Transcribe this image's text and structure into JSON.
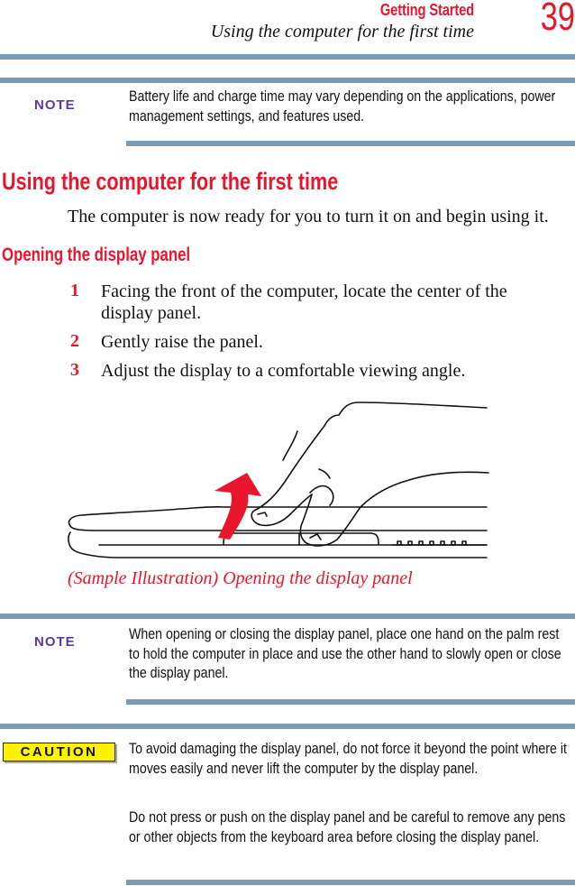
{
  "header": {
    "section": "Getting Started",
    "title": "Using the computer for the first time",
    "page_number": "39"
  },
  "notes": [
    {
      "label": "NOTE",
      "text": "Battery life and charge time may vary depending on the applications, power management settings, and features used."
    },
    {
      "label": "NOTE",
      "text": "When opening or closing the display panel, place one hand on the palm rest to hold the computer in place and use the other hand to slowly open or close the display panel."
    }
  ],
  "section": {
    "heading": "Using the computer for the first time",
    "intro": "The computer is now ready for you to turn it on and begin using it.",
    "subheading": "Opening the display panel",
    "steps": [
      {
        "number": "1",
        "text": "Facing the front of the computer, locate the center of the display panel."
      },
      {
        "number": "2",
        "text": "Gently raise the panel."
      },
      {
        "number": "3",
        "text": "Adjust the display to a comfortable viewing angle."
      }
    ]
  },
  "figure": {
    "icon": "laptop-opening-hand-illustration",
    "caption": "(Sample Illustration) Opening the display panel"
  },
  "caution": {
    "label": "CAUTION",
    "paragraphs": [
      "To avoid damaging the display panel, do not force it beyond the point where it moves easily and never lift the computer by the display panel.",
      "Do not press or push on the display panel and be careful to remove any pens or other objects from the keyboard area before closing the display panel."
    ]
  },
  "colors": {
    "accent_red": "#e8152c",
    "note_purple": "#5b3aa1",
    "rule_blue": "#7c9ab4",
    "caution_yellow": "#fff200"
  }
}
